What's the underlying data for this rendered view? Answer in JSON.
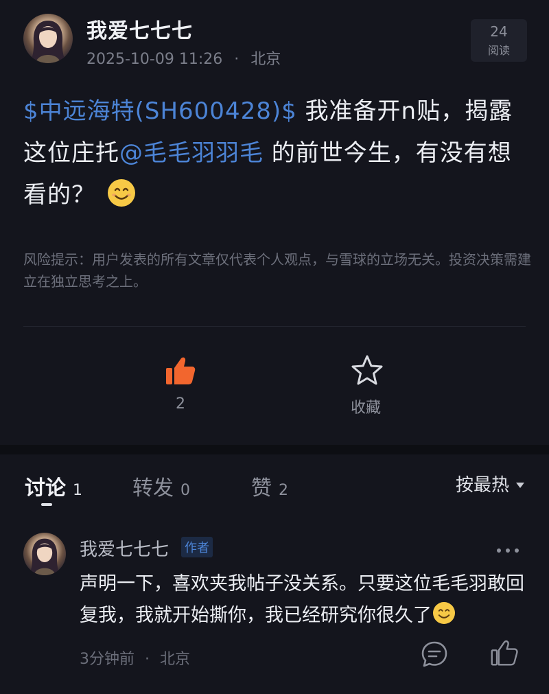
{
  "post": {
    "author": "我爱七七七",
    "datetime": "2025-10-09 11:26",
    "meta_separator": "·",
    "location": "北京",
    "reads_count": "24",
    "reads_label": "阅读",
    "stock_tag": "$中远海特(SH600428)$",
    "text_part1": " 我准备开n贴，揭露这位庄托",
    "mention": "@毛毛羽羽毛",
    "text_part2": " 的前世今生，有没有想看的？",
    "risk_notice": "风险提示：用户发表的所有文章仅代表个人观点，与雪球的立场无关。投资决策需建立在独立思考之上。",
    "like_count": "2",
    "favorite_label": "收藏"
  },
  "tabs": [
    {
      "label": "讨论",
      "count": "1"
    },
    {
      "label": "转发",
      "count": "0"
    },
    {
      "label": "赞",
      "count": "2"
    }
  ],
  "sort_label": "按最热",
  "comment": {
    "author": "我爱七七七",
    "badge": "作者",
    "text": "声明一下，喜欢夹我帖子没关系。只要这位毛毛羽敢回复我，我就开始撕你，我已经研究你很久了",
    "time": "3分钟前",
    "meta_separator": "·",
    "location": "北京"
  },
  "colors": {
    "background": "#14151d",
    "link": "#4c84d6",
    "like_accent": "#f2662e"
  },
  "icons": [
    "avatar",
    "like-icon",
    "star-icon",
    "smile-emoji",
    "more-icon",
    "reply-icon",
    "thumbs-up-outline-icon",
    "dropdown-arrow-icon"
  ]
}
